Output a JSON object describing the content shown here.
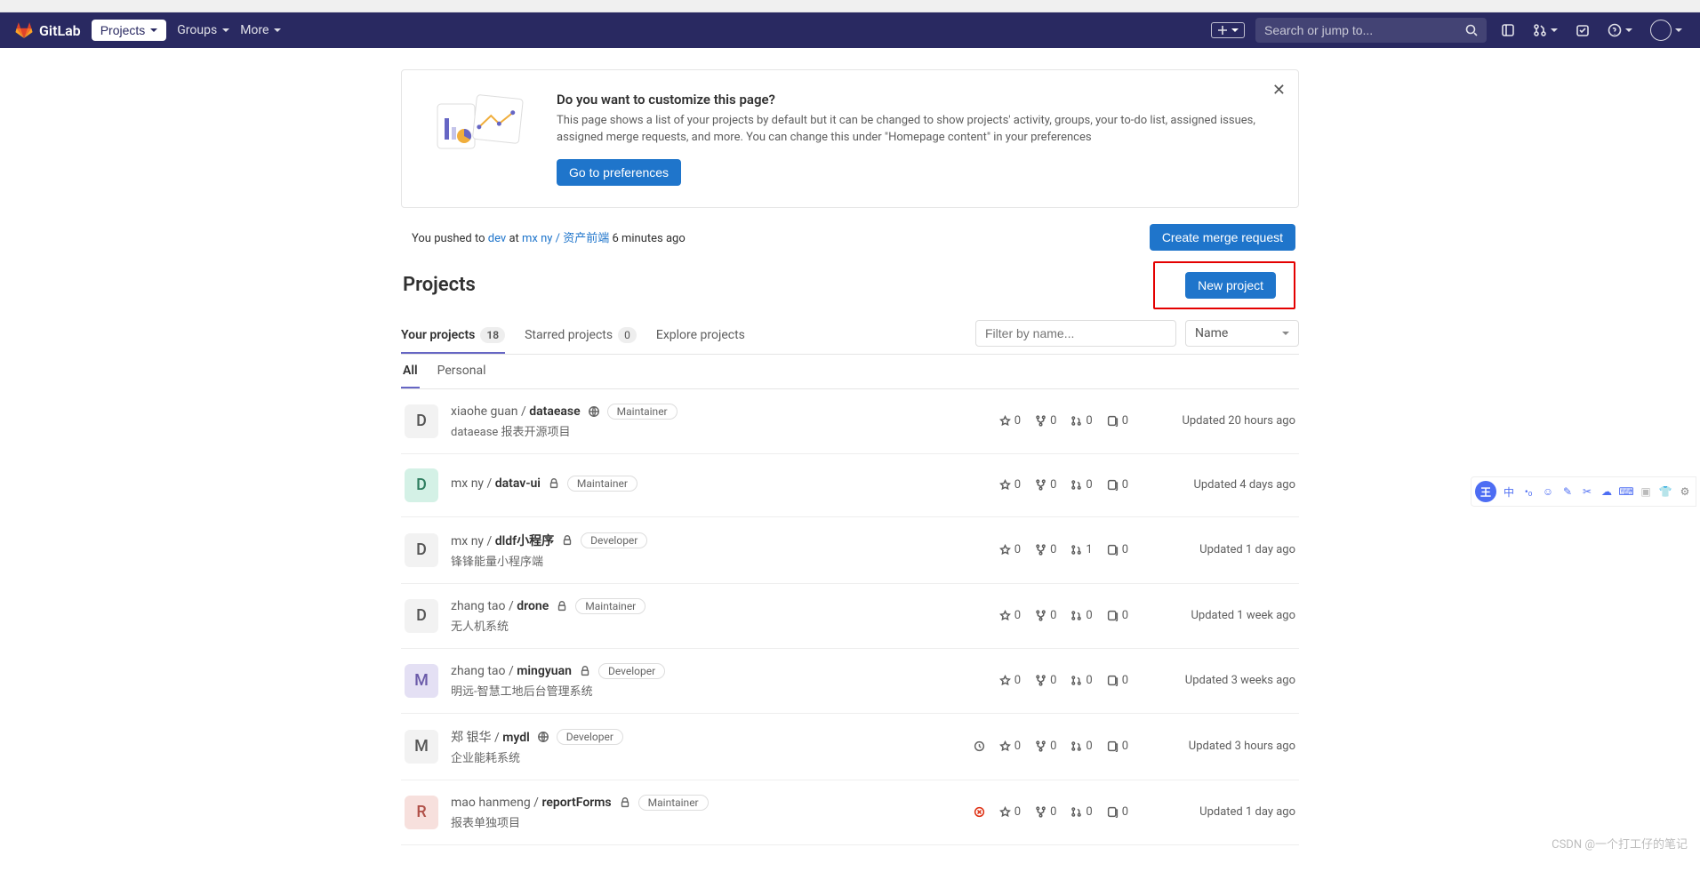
{
  "brand": "GitLab",
  "nav": {
    "projects": "Projects",
    "groups": "Groups",
    "more": "More",
    "search_placeholder": "Search or jump to..."
  },
  "banner": {
    "title": "Do you want to customize this page?",
    "desc": "This page shows a list of your projects by default but it can be changed to show projects' activity, groups, your to-do list, assigned issues, assigned merge requests, and more. You can change this under \"Homepage content\" in your preferences",
    "button": "Go to preferences"
  },
  "push": {
    "prefix": "You pushed to ",
    "branch": "dev",
    "at": " at ",
    "project": "mx ny / 资产前端",
    "ago": " 6 minutes ago",
    "merge_btn": "Create merge request"
  },
  "page_title": "Projects",
  "new_project_btn": "New project",
  "tabs": {
    "your_projects": "Your projects",
    "your_projects_count": "18",
    "starred": "Starred projects",
    "starred_count": "0",
    "explore": "Explore projects",
    "filter_placeholder": "Filter by name...",
    "sort_label": "Name"
  },
  "subtabs": {
    "all": "All",
    "personal": "Personal"
  },
  "updated_prefix": "Updated ",
  "projects": [
    {
      "letter": "D",
      "bg": "#f2f2f2",
      "fg": "#555",
      "ns": "xiaohe guan / ",
      "name": "dataease",
      "vis": "public",
      "role": "Maintainer",
      "desc": "dataease 报表开源项目",
      "stars": 0,
      "forks": 0,
      "mrs": 0,
      "issues": 0,
      "updated": "20 hours ago",
      "pipeline": ""
    },
    {
      "letter": "D",
      "bg": "#d4f1e6",
      "fg": "#2e7d5f",
      "ns": "mx ny / ",
      "name": "datav-ui",
      "vis": "private",
      "role": "Maintainer",
      "desc": "",
      "stars": 0,
      "forks": 0,
      "mrs": 0,
      "issues": 0,
      "updated": "4 days ago",
      "pipeline": ""
    },
    {
      "letter": "D",
      "bg": "#f2f2f2",
      "fg": "#555",
      "ns": "mx ny / ",
      "name": "dldf小程序",
      "vis": "private",
      "role": "Developer",
      "desc": "锋锋能量小程序端",
      "stars": 0,
      "forks": 0,
      "mrs": 1,
      "issues": 0,
      "updated": "1 day ago",
      "pipeline": ""
    },
    {
      "letter": "D",
      "bg": "#f2f2f2",
      "fg": "#555",
      "ns": "zhang tao / ",
      "name": "drone",
      "vis": "private",
      "role": "Maintainer",
      "desc": "无人机系统",
      "stars": 0,
      "forks": 0,
      "mrs": 0,
      "issues": 0,
      "updated": "1 week ago",
      "pipeline": ""
    },
    {
      "letter": "M",
      "bg": "#e4e0f4",
      "fg": "#6a5aa9",
      "ns": "zhang tao / ",
      "name": "mingyuan",
      "vis": "private",
      "role": "Developer",
      "desc": "明远-智慧工地后台管理系统",
      "stars": 0,
      "forks": 0,
      "mrs": 0,
      "issues": 0,
      "updated": "3 weeks ago",
      "pipeline": ""
    },
    {
      "letter": "M",
      "bg": "#f2f2f2",
      "fg": "#555",
      "ns": "郑 银华 / ",
      "name": "mydl",
      "vis": "public",
      "role": "Developer",
      "desc": "企业能耗系统",
      "stars": 0,
      "forks": 0,
      "mrs": 0,
      "issues": 0,
      "updated": "3 hours ago",
      "pipeline": "pending"
    },
    {
      "letter": "R",
      "bg": "#f7e0dd",
      "fg": "#b05048",
      "ns": "mao hanmeng / ",
      "name": "reportForms",
      "vis": "private",
      "role": "Maintainer",
      "desc": "报表单独项目",
      "stars": 0,
      "forks": 0,
      "mrs": 0,
      "issues": 0,
      "updated": "1 day ago",
      "pipeline": "failed"
    }
  ],
  "watermark": "CSDN @一个打工仔的笔记"
}
